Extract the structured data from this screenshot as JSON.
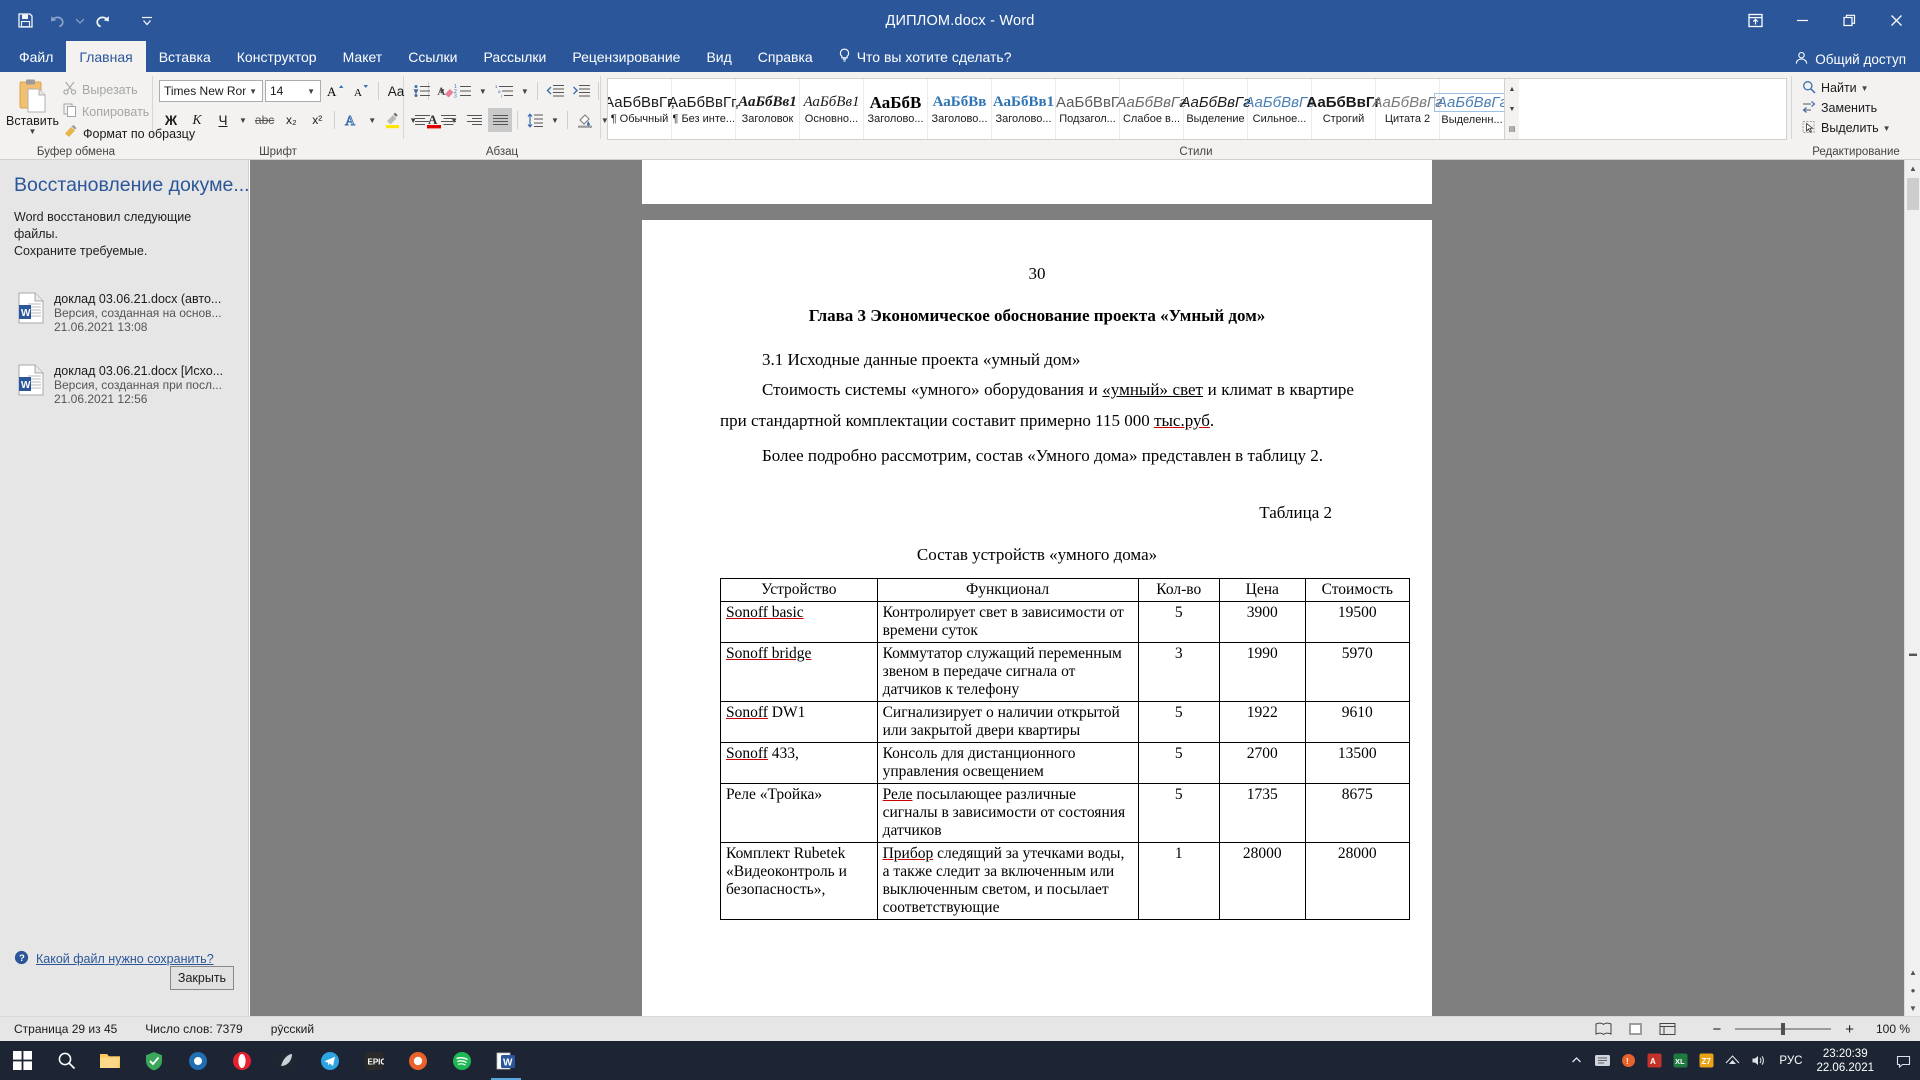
{
  "window": {
    "title": "ДИПЛОМ.docx  -  Word",
    "controls": {
      "ribbon_display": "ribbon-display-options",
      "minimize": "minimize",
      "restore": "restore",
      "close": "close"
    }
  },
  "quick_access": [
    {
      "name": "save",
      "icon": "save-icon"
    },
    {
      "name": "undo",
      "icon": "undo-icon"
    },
    {
      "name": "redo",
      "icon": "redo-icon"
    },
    {
      "name": "customize",
      "icon": "chevron-down-icon"
    }
  ],
  "tabs": [
    {
      "label": "Файл",
      "active": false
    },
    {
      "label": "Главная",
      "active": true
    },
    {
      "label": "Вставка",
      "active": false
    },
    {
      "label": "Конструктор",
      "active": false
    },
    {
      "label": "Макет",
      "active": false
    },
    {
      "label": "Ссылки",
      "active": false
    },
    {
      "label": "Рассылки",
      "active": false
    },
    {
      "label": "Рецензирование",
      "active": false
    },
    {
      "label": "Вид",
      "active": false
    },
    {
      "label": "Справка",
      "active": false
    }
  ],
  "tell_me": "Что вы хотите сделать?",
  "share": "Общий доступ",
  "ribbon": {
    "clipboard": {
      "label": "Буфер обмена",
      "paste": "Вставить",
      "cut": "Вырезать",
      "copy": "Копировать",
      "format_painter": "Формат по образцу"
    },
    "font": {
      "label": "Шрифт",
      "font_name": "Times New Roma",
      "font_size": "14",
      "bold": "Ж",
      "italic": "К",
      "underline": "Ч",
      "strikethrough": "abc",
      "subscript": "x₂",
      "superscript": "x²"
    },
    "paragraph": {
      "label": "Абзац"
    },
    "styles": {
      "label": "Стили",
      "items": [
        {
          "preview": "АаБбВвГг,",
          "name": "¶ Обычный",
          "style": "normal"
        },
        {
          "preview": "АаБбВвГг,",
          "name": "¶ Без инте...",
          "style": "normal"
        },
        {
          "preview": "АаБбВв1",
          "name": "Заголовок",
          "style": "bold-italic-serif"
        },
        {
          "preview": "АаБбВв1",
          "name": "Основно...",
          "style": "italic-serif"
        },
        {
          "preview": "АаБбВ",
          "name": "Заголово...",
          "style": "bold-serif"
        },
        {
          "preview": "АаБбВв",
          "name": "Заголово...",
          "style": "blue-serif"
        },
        {
          "preview": "АаБбВв1",
          "name": "Заголово...",
          "style": "blue-serif"
        },
        {
          "preview": "АаБбВвГ",
          "name": "Подзагол...",
          "style": "gray"
        },
        {
          "preview": "АаБбВвГг",
          "name": "Слабое в...",
          "style": "italic-gray"
        },
        {
          "preview": "АаБбВвГг",
          "name": "Выделение",
          "style": "italic-dark"
        },
        {
          "preview": "АаБбВвГг",
          "name": "Сильное...",
          "style": "blue-italic"
        },
        {
          "preview": "АаБбВвГг",
          "name": "Строгий",
          "style": "bold-dark"
        },
        {
          "preview": "АаБбВвГг",
          "name": "Цитата 2",
          "style": "gray-italic"
        },
        {
          "preview": "АаБбВвГг",
          "name": "Выделенн...",
          "style": "blue-box"
        }
      ]
    },
    "editing": {
      "label": "Редактирование",
      "find": "Найти",
      "replace": "Заменить",
      "select": "Выделить"
    }
  },
  "recovery_pane": {
    "title": "Восстановление докуме...",
    "description_line1": "Word восстановил следующие файлы.",
    "description_line2": "Сохраните требуемые.",
    "files": [
      {
        "name": "доклад  03.06.21.docx  (авто...",
        "subtitle": "Версия, созданная на основ...",
        "date": "21.06.2021 13:08"
      },
      {
        "name": "доклад  03.06.21.docx  [Исхо...",
        "subtitle": "Версия, созданная при посл...",
        "date": "21.06.2021 12:56"
      }
    ],
    "help_link": "Какой файл нужно сохранить?",
    "close_button": "Закрыть"
  },
  "document": {
    "page_number": "30",
    "heading": "Глава 3 Экономическое обоснование проекта «Умный дом»",
    "subheading": "3.1 Исходные данные проекта «умный дом»",
    "paragraph_1a": "Стоимость системы «умного» оборудования и ",
    "paragraph_1b": "«умный» свет",
    "paragraph_1c": " и климат в квартире при стандартной комплектации составит примерно 115 000 ",
    "paragraph_1d": "тыс.руб",
    "paragraph_1e": ".",
    "paragraph_2": "Более подробно рассмотрим, состав «Умного дома» представлен в таблицу 2.",
    "table_caption": "Таблица 2",
    "table_title": "Состав устройств «умного дома»",
    "table": {
      "headers": [
        "Устройство",
        "Функционал",
        "Кол-во",
        "Цена",
        "Стоимость"
      ],
      "rows": [
        {
          "device_u": "Sonoff basic",
          "device_rest": "",
          "func": "Контролирует свет в зависимости от времени суток",
          "func_u": "",
          "qty": "5",
          "price": "3900",
          "cost": "19500"
        },
        {
          "device_u": "Sonoff bridge",
          "device_rest": "",
          "func": "Коммутатор служащий переменным звеном в передаче сигнала от датчиков к телефону",
          "func_u": "",
          "qty": "3",
          "price": "1990",
          "cost": "5970"
        },
        {
          "device_u": "Sonoff",
          "device_rest": " DW1",
          "func": "Сигнализирует о наличии открытой или закрытой двери квартиры",
          "func_u": "",
          "qty": "5",
          "price": "1922",
          "cost": "9610"
        },
        {
          "device_u": "Sonoff",
          "device_rest": " 433,",
          "func": "Консоль для дистанционного управления освещением",
          "func_u": "",
          "qty": "5",
          "price": "2700",
          "cost": "13500"
        },
        {
          "device_u": "",
          "device_rest": "Реле «Тройка»",
          "func_u": "Реле",
          "func": " посылающее различные сигналы в зависимости от состояния датчиков",
          "qty": "5",
          "price": "1735",
          "cost": "8675"
        },
        {
          "device_u": "",
          "device_rest": "Комплект Rubetek «Видеоконтроль и безопасность»,",
          "func_u": "Прибор",
          "func": " следящий за утечками воды, а также следит за включенным или выключенным светом, и посылает соответствующие",
          "qty": "1",
          "price": "28000",
          "cost": "28000"
        }
      ]
    }
  },
  "status_bar": {
    "page": "Страница 29 из 45",
    "words": "Число слов: 7379",
    "language": "рӯсский",
    "zoom": "100 %",
    "zoom_out": "−",
    "zoom_in": "+",
    "views": [
      "read-mode-icon",
      "print-layout-icon",
      "web-layout-icon"
    ]
  },
  "taskbar": {
    "items": [
      {
        "name": "start-button",
        "icon": "windows-icon"
      },
      {
        "name": "search-button",
        "icon": "search-icon"
      },
      {
        "name": "file-explorer",
        "icon": "folder-icon"
      },
      {
        "name": "app-green",
        "icon": "shield-icon"
      },
      {
        "name": "app-blue-circle",
        "icon": "circle-icon"
      },
      {
        "name": "opera-browser",
        "icon": "opera-icon"
      },
      {
        "name": "app-dark",
        "icon": "feather-icon"
      },
      {
        "name": "telegram",
        "icon": "telegram-icon"
      },
      {
        "name": "epic-games",
        "icon": "epic-icon"
      },
      {
        "name": "app-orange",
        "icon": "photos-icon"
      },
      {
        "name": "spotify",
        "icon": "spotify-icon"
      },
      {
        "name": "word-active",
        "icon": "word-icon"
      }
    ],
    "tray": {
      "chevron": "show-hidden-icons",
      "language": "РУС",
      "time": "23:20:39",
      "date": "22.06.2021"
    }
  },
  "colors": {
    "word_blue": "#2b579a",
    "ribbon_bg": "#f3f2f1",
    "pane_bg": "#e6e6e6",
    "doc_bg": "#7f7f7f",
    "taskbar": "#1d2433",
    "accent_red": "#c00000"
  }
}
